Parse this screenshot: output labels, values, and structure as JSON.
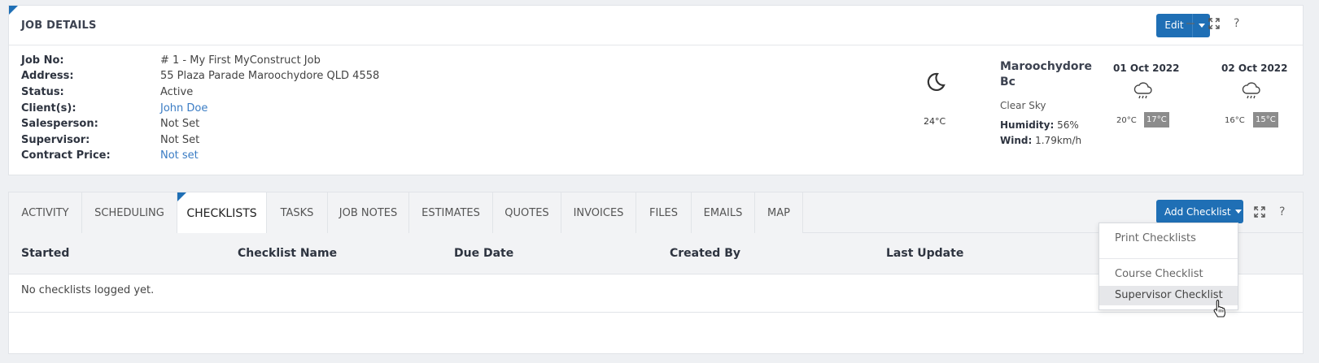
{
  "job_details": {
    "title": "JOB DETAILS",
    "edit_label": "Edit",
    "fields": [
      {
        "label": "Job No:",
        "value": "# 1 - My First MyConstruct Job",
        "link": false
      },
      {
        "label": "Address:",
        "value": "55 Plaza Parade Maroochydore QLD 4558",
        "link": false
      },
      {
        "label": "Status:",
        "value": "Active",
        "link": false
      },
      {
        "label": "Client(s):",
        "value": "John Doe",
        "link": true
      },
      {
        "label": "Salesperson:",
        "value": "Not Set",
        "link": false
      },
      {
        "label": "Supervisor:",
        "value": "Not Set",
        "link": false
      },
      {
        "label": "Contract Price:",
        "value": "Not set",
        "link": true
      }
    ]
  },
  "weather": {
    "current_temp": "24°C",
    "location": "Maroochydore Bc",
    "condition": "Clear Sky",
    "humidity_label": "Humidity:",
    "humidity": "56%",
    "wind_label": "Wind:",
    "wind": "1.79km/h",
    "forecast": [
      {
        "date": "01 Oct 2022",
        "low": "20°C",
        "high": "17°C"
      },
      {
        "date": "02 Oct 2022",
        "low": "16°C",
        "high": "15°C"
      }
    ]
  },
  "tabs": [
    {
      "label": "ACTIVITY",
      "active": false
    },
    {
      "label": "SCHEDULING",
      "active": false
    },
    {
      "label": "CHECKLISTS",
      "active": true
    },
    {
      "label": "TASKS",
      "active": false
    },
    {
      "label": "JOB NOTES",
      "active": false
    },
    {
      "label": "ESTIMATES",
      "active": false
    },
    {
      "label": "QUOTES",
      "active": false
    },
    {
      "label": "INVOICES",
      "active": false
    },
    {
      "label": "FILES",
      "active": false
    },
    {
      "label": "EMAILS",
      "active": false
    },
    {
      "label": "MAP",
      "active": false
    }
  ],
  "checklists": {
    "add_label": "Add Checklist",
    "columns": [
      "Started",
      "Checklist Name",
      "Due Date",
      "Created By",
      "Last Update"
    ],
    "empty_text": "No checklists logged yet.",
    "dropdown": {
      "print_label": "Print Checklists",
      "items": [
        "Course Checklist",
        "Supervisor Checklist"
      ],
      "hovered": "Supervisor Checklist"
    }
  },
  "colors": {
    "accent": "#1f6fb5",
    "link": "#3a7cc4"
  }
}
